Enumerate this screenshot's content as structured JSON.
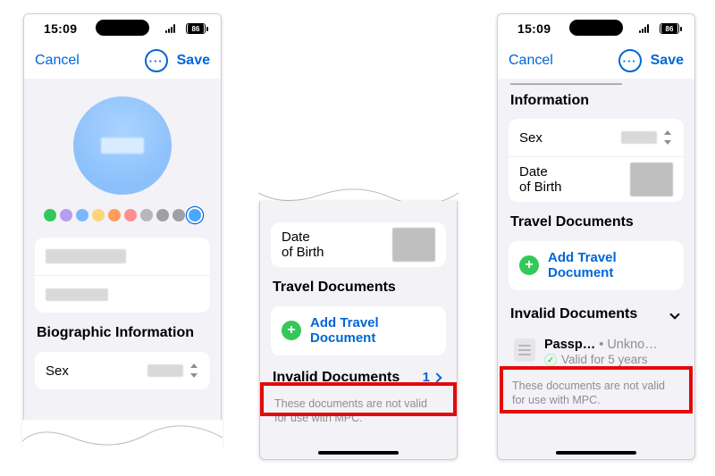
{
  "status": {
    "time": "15:09",
    "battery": "86"
  },
  "nav": {
    "cancel": "Cancel",
    "save": "Save"
  },
  "swatches": [
    "#34c759",
    "#b99df0",
    "#7bb7ff",
    "#ffd479",
    "#ff9d5c",
    "#ff8f8f",
    "#b7b7bb",
    "#9f9fa3",
    "#a0a0a4",
    "#4aa7ff"
  ],
  "headings": {
    "bio_short": "Biographic",
    "bio_long": "Biographic Information",
    "information": "Information",
    "travel": "Travel Documents",
    "invalid": "Invalid Documents"
  },
  "fields": {
    "sex": "Sex",
    "dob": "Date of Birth",
    "dob_l1": "Date",
    "dob_l2": "of Birth"
  },
  "actions": {
    "add_travel_l1": "Add Travel",
    "add_travel_l2": "Document"
  },
  "invalid": {
    "count": "1",
    "footnote": "These documents are not valid for use with MPC."
  },
  "doc": {
    "name": "Passp…",
    "sub": "Unkno…",
    "validity": "Valid for 5 years"
  }
}
